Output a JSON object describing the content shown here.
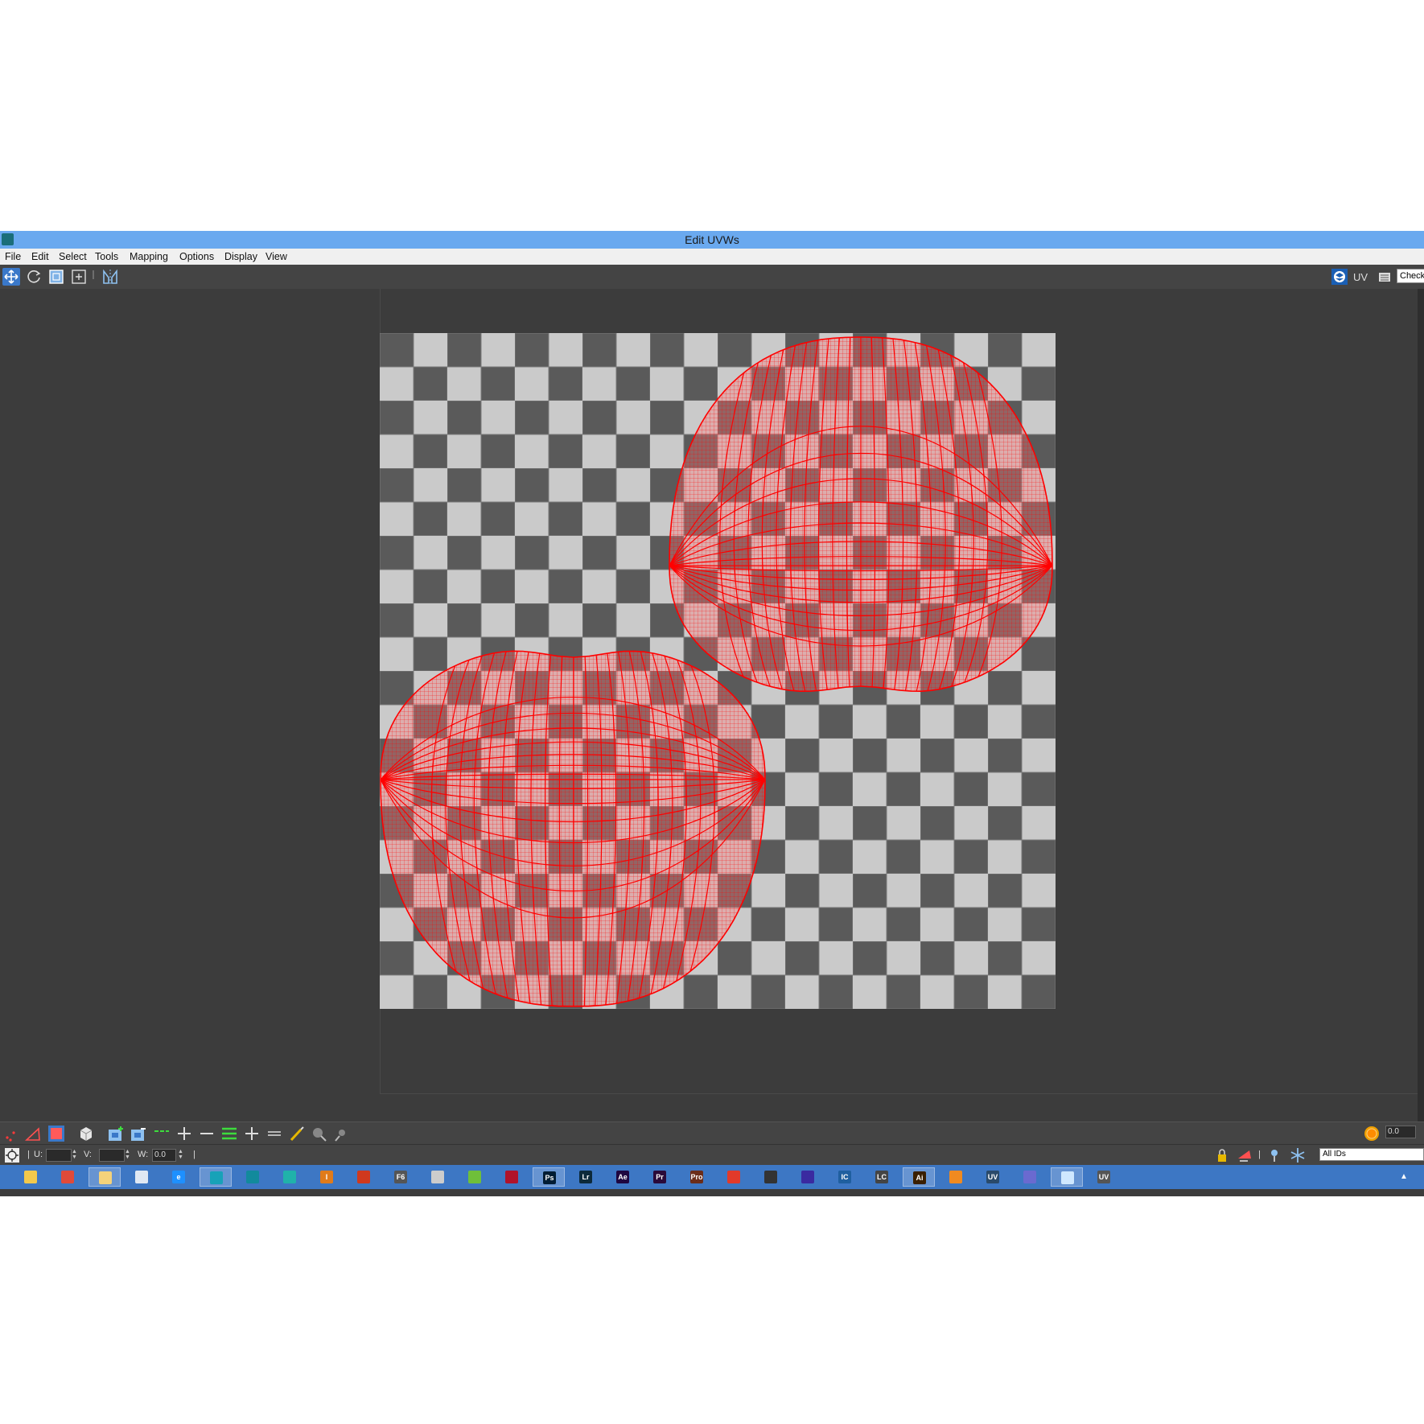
{
  "window": {
    "title": "Edit UVWs"
  },
  "menu": [
    "File",
    "Edit",
    "Select",
    "Tools",
    "Mapping",
    "Options",
    "Display",
    "View"
  ],
  "toolbar": {
    "tools": [
      "move-tool",
      "rotate-tool",
      "scale-tool",
      "freeform-tool",
      "mirror-tool"
    ],
    "uv_label": "UV",
    "texture_dropdown": "Check"
  },
  "bottom_toolbar": {
    "tools": [
      "vertex-subobject",
      "edge-subobject",
      "polygon-subobject",
      "select-by-element",
      "grow-selection",
      "shrink-selection",
      "loop-select",
      "grow-loop",
      "shrink-loop",
      "ring-select",
      "grow-ring",
      "shrink-ring",
      "paint-select",
      "paint-grow",
      "paint-shrink"
    ],
    "soft_value": "0.0"
  },
  "status": {
    "u_label": "U:",
    "u_value": "",
    "v_label": "V:",
    "v_value": "",
    "w_label": "W:",
    "w_value": "0.0",
    "id_filter": "All IDs"
  },
  "taskbar": {
    "items": [
      {
        "name": "python",
        "label": "",
        "color": "#f2c94c"
      },
      {
        "name": "chrome",
        "label": "",
        "color": "#e04a3a"
      },
      {
        "name": "explorer",
        "label": "",
        "color": "#f4d27a"
      },
      {
        "name": "notepad",
        "label": "",
        "color": "#dfe8f3"
      },
      {
        "name": "internet-explorer",
        "label": "e",
        "color": "#1e90ff"
      },
      {
        "name": "3dsmax",
        "label": "",
        "color": "#17a2b8"
      },
      {
        "name": "maya",
        "label": "",
        "color": "#128a9c"
      },
      {
        "name": "mudbox",
        "label": "",
        "color": "#20b2aa"
      },
      {
        "name": "app-i",
        "label": "I",
        "color": "#e07b1a"
      },
      {
        "name": "app-red",
        "label": "",
        "color": "#d0391e"
      },
      {
        "name": "f6",
        "label": "F6",
        "color": "#555555"
      },
      {
        "name": "unity",
        "label": "",
        "color": "#cccccc"
      },
      {
        "name": "app-green",
        "label": "",
        "color": "#6fbf3a"
      },
      {
        "name": "app-ladybug",
        "label": "",
        "color": "#b0132a"
      },
      {
        "name": "photoshop",
        "label": "Ps",
        "color": "#001d34"
      },
      {
        "name": "lightroom",
        "label": "Lr",
        "color": "#0d2a3a"
      },
      {
        "name": "after-effects",
        "label": "Ae",
        "color": "#1f0740"
      },
      {
        "name": "premiere",
        "label": "Pr",
        "color": "#2a0a3a"
      },
      {
        "name": "app-pro",
        "label": "Pro",
        "color": "#6b2d1a"
      },
      {
        "name": "app-flame",
        "label": "",
        "color": "#e23a2a"
      },
      {
        "name": "app-camera",
        "label": "",
        "color": "#333333"
      },
      {
        "name": "app-blue-sphere",
        "label": "",
        "color": "#3a2aa0"
      },
      {
        "name": "app-ic",
        "label": "IC",
        "color": "#1f5f9f"
      },
      {
        "name": "app-lc",
        "label": "LC",
        "color": "#444444"
      },
      {
        "name": "illustrator",
        "label": "Ai",
        "color": "#3a1f00"
      },
      {
        "name": "blender",
        "label": "",
        "color": "#f08a20"
      },
      {
        "name": "uvlayout-1",
        "label": "UV",
        "color": "#2a4a6a"
      },
      {
        "name": "app-screen",
        "label": "",
        "color": "#6a6ad0"
      },
      {
        "name": "app-doc",
        "label": "",
        "color": "#cfe8ff"
      },
      {
        "name": "uvlayout-2",
        "label": "UV",
        "color": "#555555"
      }
    ]
  },
  "colors": {
    "mesh": "#ff0000",
    "checker_light": "#cacaca",
    "checker_dark": "#5a5a5a",
    "workspace": "#3c3c3c"
  }
}
